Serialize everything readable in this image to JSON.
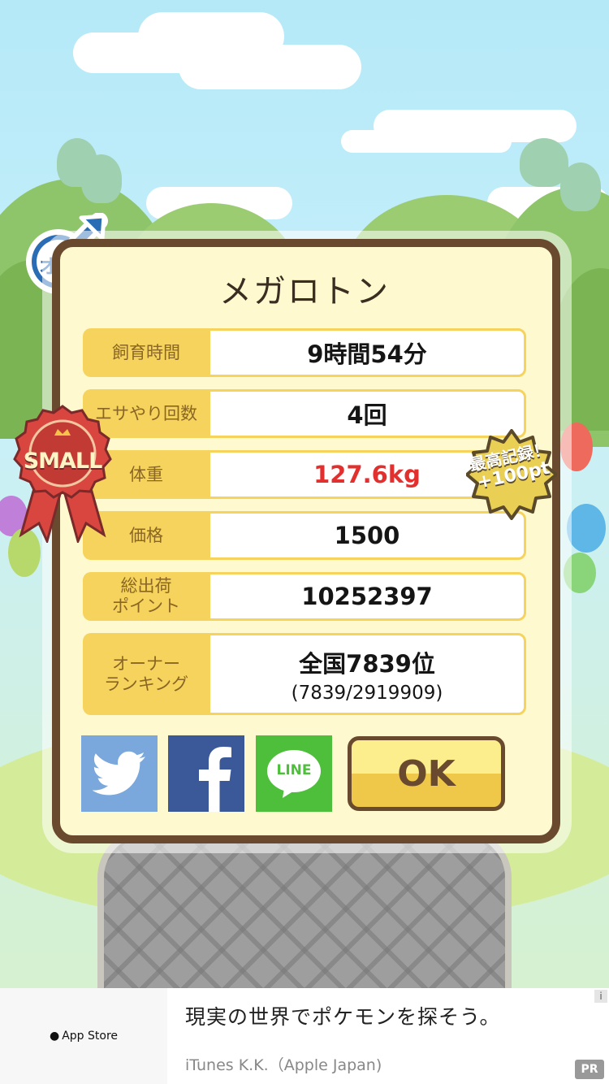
{
  "gender_badge": {
    "label": "オス"
  },
  "pet_name": "メガロトン",
  "stats": [
    {
      "label": "飼育時間",
      "value": "9時間54分"
    },
    {
      "label": "エサやり回数",
      "value": "4回"
    },
    {
      "label": "体重",
      "value": "127.6kg"
    },
    {
      "label": "価格",
      "value": "1500"
    },
    {
      "label_line1": "総出荷",
      "label_line2": "ポイント",
      "value": "10252397"
    },
    {
      "label_line1": "オーナー",
      "label_line2": "ランキング",
      "value": "全国7839位",
      "sub": "(7839/2919909)"
    }
  ],
  "ribbon": {
    "label": "SMALL"
  },
  "record_badge": {
    "line1": "最高記録！",
    "line2": "+100pt"
  },
  "share": {
    "twitter_icon": "twitter-bird-icon",
    "facebook_icon": "facebook-f-icon",
    "line_label": "LINE"
  },
  "ok_label": "OK",
  "ad": {
    "store_label": "App Store",
    "title": "現実の世界でポケモンを探そう。",
    "publisher": "iTunes K.K.（Apple Japan)",
    "info_label": "i",
    "pr_label": "PR"
  },
  "colors": {
    "panel_bg": "#fff9cf",
    "panel_border": "#6a4a2e",
    "label_bg": "#f6d35d",
    "weight_red": "#e2302f",
    "twitter": "#7aa8dc",
    "facebook": "#3b5998",
    "line": "#4dbf3b"
  }
}
